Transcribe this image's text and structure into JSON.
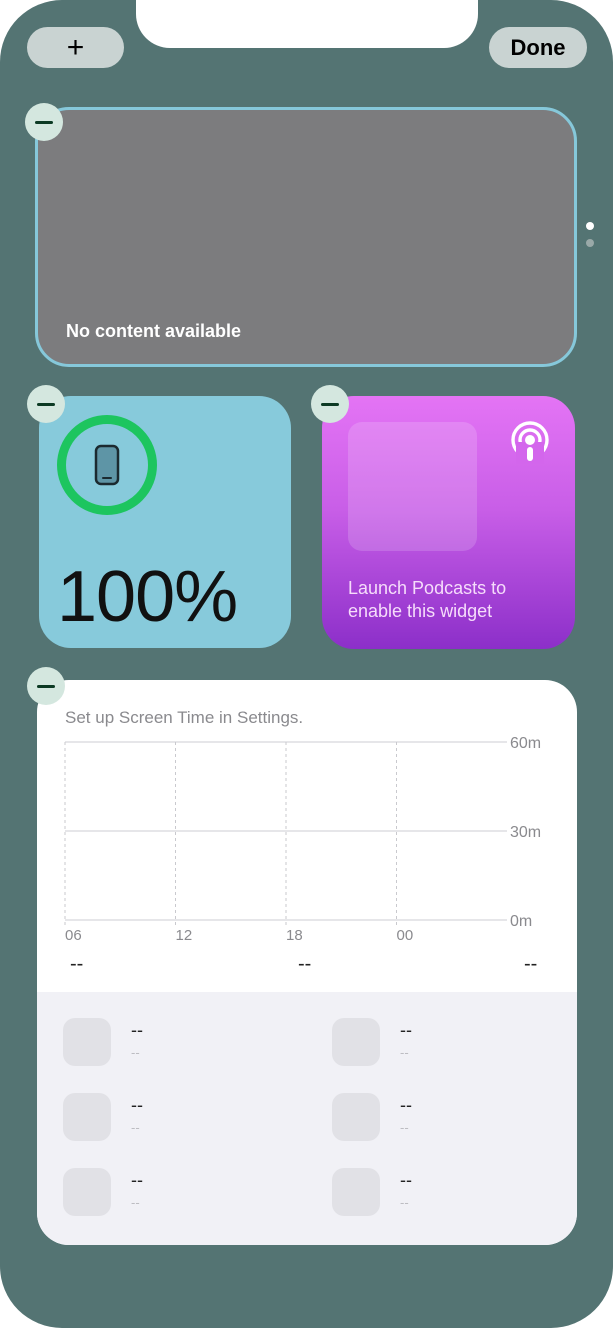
{
  "header": {
    "add_label": "+",
    "done_label": "Done"
  },
  "large_widget": {
    "message": "No content available"
  },
  "page_indicator": {
    "pages": 2,
    "current": 1
  },
  "battery_widget": {
    "percent_label": "100%",
    "level": 1.0,
    "ring_color": "#1dc55f",
    "device_icon": "iphone-icon"
  },
  "podcast_widget": {
    "message_line1": "Launch Podcasts to",
    "message_line2": "enable this widget",
    "icon": "podcasts-icon"
  },
  "screen_time_widget": {
    "title": "Set up Screen Time in Settings.",
    "totals": [
      "--",
      "--",
      "--"
    ],
    "apps": [
      {
        "name": "--",
        "time": "--"
      },
      {
        "name": "--",
        "time": "--"
      },
      {
        "name": "--",
        "time": "--"
      },
      {
        "name": "--",
        "time": "--"
      },
      {
        "name": "--",
        "time": "--"
      },
      {
        "name": "--",
        "time": "--"
      }
    ]
  },
  "chart_data": {
    "type": "bar",
    "categories": [
      "06",
      "12",
      "18",
      "00"
    ],
    "values": [],
    "y_tick_labels": [
      "60m",
      "30m",
      "0m"
    ],
    "ylim": [
      0,
      60
    ],
    "grid": true
  },
  "colors": {
    "background": "#547473",
    "podcast_gradient_top": "#e474f5",
    "podcast_gradient_bottom": "#8c2fc9",
    "battery_widget_bg": "#87cadb",
    "large_widget_bg": "#7c7c7e",
    "large_widget_border": "#86c8da"
  }
}
